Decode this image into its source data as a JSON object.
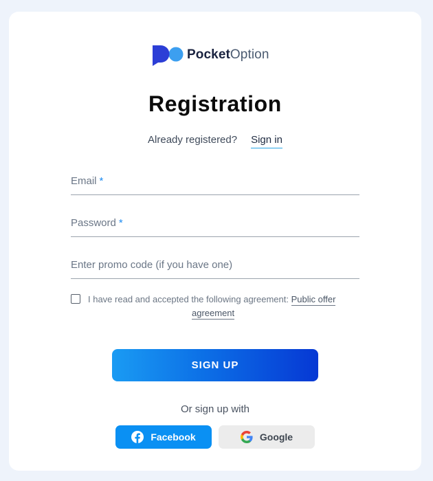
{
  "brand": {
    "name_bold": "Pocket",
    "name_light": "Option",
    "colors": {
      "mark_dark": "#2c3ed6",
      "mark_light": "#3c9ff0"
    }
  },
  "page": {
    "title": "Registration",
    "already_text": "Already registered?",
    "sign_in_link": "Sign in"
  },
  "form": {
    "email_label": "Email",
    "password_label": "Password",
    "required_mark": "*",
    "promo_placeholder": "Enter promo code (if you have one)",
    "agreement_text": "I have read and accepted the following agreement:",
    "agreement_link_part1": "Public offer",
    "agreement_link_part2": "agreement",
    "agreement_checked": false,
    "submit_label": "SIGN UP"
  },
  "social": {
    "or_text": "Or sign up with",
    "facebook_label": "Facebook",
    "google_label": "Google",
    "facebook_icon": "facebook-icon",
    "google_icon": "google-icon",
    "facebook_color": "#0a90f3",
    "google_bg": "#ececec"
  },
  "colors": {
    "background": "#eef3fb",
    "card": "#ffffff",
    "accent": "#1d8bf1",
    "button_gradient_start": "#1a9bf3",
    "button_gradient_end": "#0638d4"
  }
}
